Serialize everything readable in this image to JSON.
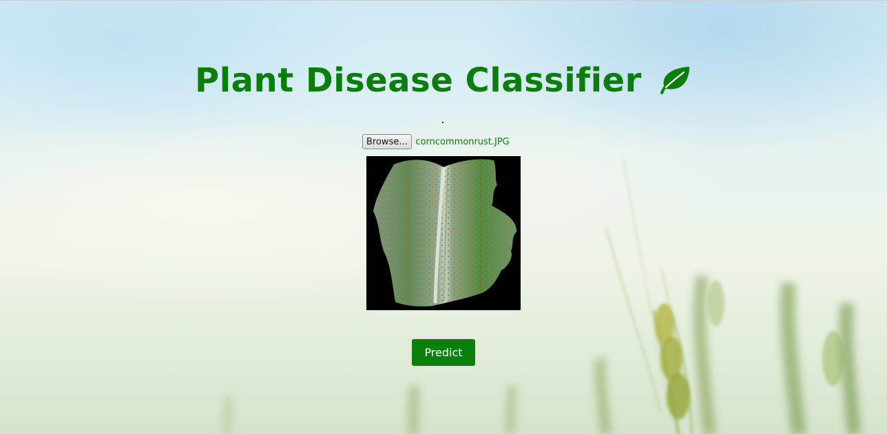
{
  "header": {
    "title": "Plant Disease Classifier",
    "title_icon": "leaf-icon",
    "title_color": "#0a7d0a"
  },
  "upload": {
    "browse_label": "Browse…",
    "selected_file": "corncommonrust.JPG"
  },
  "preview": {
    "image_name": "corn-leaf-common-rust-image"
  },
  "actions": {
    "predict_label": "Predict",
    "predict_color": "#0a800a"
  }
}
